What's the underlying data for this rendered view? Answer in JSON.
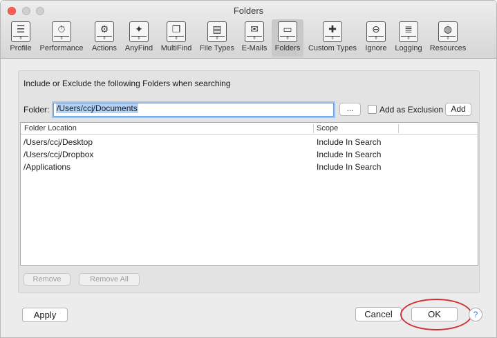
{
  "window": {
    "title": "Folders"
  },
  "toolbar": {
    "items": [
      {
        "label": "Profile",
        "icon": "profile-icon",
        "glyph": "☰",
        "selected": false
      },
      {
        "label": "Performance",
        "icon": "stopwatch-icon",
        "glyph": "⏱",
        "selected": false
      },
      {
        "label": "Actions",
        "icon": "gear-icon",
        "glyph": "⚙",
        "selected": false
      },
      {
        "label": "AnyFind",
        "icon": "puzzle-icon",
        "glyph": "✦",
        "selected": false
      },
      {
        "label": "MultiFind",
        "icon": "windows-icon",
        "glyph": "❐",
        "selected": false
      },
      {
        "label": "File Types",
        "icon": "document-icon",
        "glyph": "▤",
        "selected": false
      },
      {
        "label": "E-Mails",
        "icon": "envelope-icon",
        "glyph": "✉",
        "selected": false
      },
      {
        "label": "Folders",
        "icon": "folder-icon",
        "glyph": "▭",
        "selected": true
      },
      {
        "label": "Custom Types",
        "icon": "custom-types-icon",
        "glyph": "✚",
        "selected": false
      },
      {
        "label": "Ignore",
        "icon": "no-entry-icon",
        "glyph": "⊖",
        "selected": false
      },
      {
        "label": "Logging",
        "icon": "log-icon",
        "glyph": "≣",
        "selected": false
      },
      {
        "label": "Resources",
        "icon": "globe-icon",
        "glyph": "◍",
        "selected": false
      }
    ]
  },
  "panel": {
    "heading": "Include or Exclude the following Folders when searching",
    "folder_label": "Folder:",
    "folder_value": "/Users/ccj/Documents",
    "browse_label": "...",
    "exclusion_label": "Add as Exclusion",
    "exclusion_checked": false,
    "add_label": "Add"
  },
  "table": {
    "columns": [
      "Folder Location",
      "Scope"
    ],
    "rows": [
      {
        "location": "/Users/ccj/Desktop",
        "scope": "Include In Search"
      },
      {
        "location": "/Users/ccj/Dropbox",
        "scope": "Include In Search"
      },
      {
        "location": "/Applications",
        "scope": "Include In Search"
      }
    ]
  },
  "list_actions": {
    "remove_label": "Remove",
    "remove_all_label": "Remove All"
  },
  "footer": {
    "apply_label": "Apply",
    "cancel_label": "Cancel",
    "ok_label": "OK",
    "help_label": "?"
  },
  "colors": {
    "accent": "#6a9cd8",
    "annotation": "#d03030",
    "close": "#fc5f57"
  }
}
